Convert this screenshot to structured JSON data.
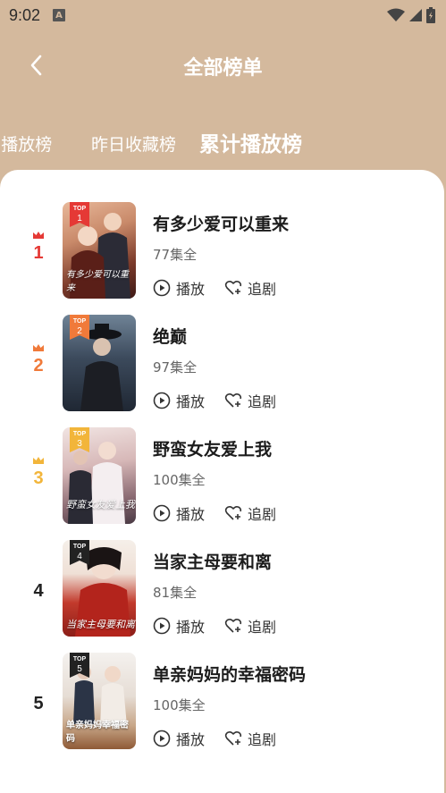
{
  "status_bar": {
    "time": "9:02",
    "notification_icon": "A"
  },
  "header": {
    "title": "全部榜单"
  },
  "tabs": [
    {
      "label": "l播放榜",
      "active": false
    },
    {
      "label": "昨日收藏榜",
      "active": false
    },
    {
      "label": "累计播放榜",
      "active": true
    }
  ],
  "actions": {
    "play_label": "播放",
    "follow_label": "追剧"
  },
  "colors": {
    "header_bg": "#d4b99d",
    "rank1": "#e53935",
    "rank2": "#f07a3a",
    "rank3": "#f2b53a"
  },
  "items": [
    {
      "rank": "1",
      "title": "有多少爱可以重来",
      "episodes": "77集全",
      "badge_top": "TOP",
      "badge_num": "1",
      "poster_text": "有多少爱可以重来"
    },
    {
      "rank": "2",
      "title": "绝巅",
      "episodes": "97集全",
      "badge_top": "TOP",
      "badge_num": "2",
      "poster_text": ""
    },
    {
      "rank": "3",
      "title": "野蛮女友爱上我",
      "episodes": "100集全",
      "badge_top": "TOP",
      "badge_num": "3",
      "poster_text": "野蛮女友爱上我"
    },
    {
      "rank": "4",
      "title": "当家主母要和离",
      "episodes": "81集全",
      "badge_top": "TOP",
      "badge_num": "4",
      "poster_text": "当家主母要和离"
    },
    {
      "rank": "5",
      "title": "单亲妈妈的幸福密码",
      "episodes": "100集全",
      "badge_top": "TOP",
      "badge_num": "5",
      "poster_text": "单亲妈妈幸福密码"
    }
  ]
}
